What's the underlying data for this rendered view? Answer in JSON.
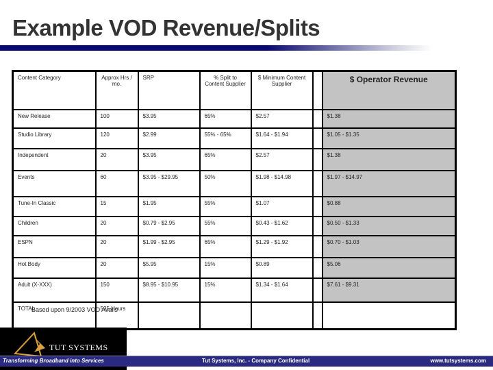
{
  "title": "Example VOD Revenue/Splits",
  "table": {
    "headers": [
      "Content Category",
      "Approx Hrs / mo.",
      "SRP",
      "% Split to Content Supplier",
      "$ Minimum Content Supplier",
      "",
      "$ Operator Revenue"
    ],
    "rows": [
      [
        "New Release",
        "100",
        "$3.95",
        "65%",
        "$2.57",
        "",
        "$1.38"
      ],
      [
        "Studio Library",
        "120",
        "$2.99",
        "55% - 65%",
        "$1.64 - $1.94",
        "",
        "$1.05 - $1.35"
      ],
      [
        "Independent",
        "20",
        "$3.95",
        "65%",
        "$2.57",
        "",
        "$1.38"
      ],
      [
        "Events",
        "60",
        "$3.95 - $29.95",
        "50%",
        "$1.98 - $14.98",
        "",
        "$1.97 - $14.97"
      ],
      [
        "Tune-In Classic",
        "15",
        "$1.95",
        "55%",
        "$1.07",
        "",
        "$0.88"
      ],
      [
        "Children",
        "20",
        "$0.79 - $2.95",
        "55%",
        "$0.43 - $1.62",
        "",
        "$0.50 - $1.33"
      ],
      [
        "ESPN",
        "20",
        "$1.99 - $2.95",
        "65%",
        "$1.29 - $1.92",
        "",
        "$0.70 - $1.03"
      ],
      [
        "Hot Body",
        "20",
        "$5.95",
        "15%",
        "$0.89",
        "",
        "$5.06"
      ],
      [
        "Adult (X-XXX)",
        "150",
        "$8.95 - $10.95",
        "15%",
        "$1.34 - $1.64",
        "",
        "$7.61 - $9.31"
      ],
      [
        "TOTAL",
        "525 Hours",
        "",
        "",
        "",
        "",
        ""
      ]
    ]
  },
  "note": "Based upon 9/2003 VOD Avails",
  "footer": {
    "logo": "TUT SYSTEMS",
    "tagline": "Transforming Broadband into Services",
    "confidential": "Tut Systems, Inc. - Company Confidential",
    "url": "www.tutsystems.com"
  },
  "colors": {
    "title_rule": "#0a0a6e",
    "operator_column": "#c3c3c3",
    "footer_band": "#2a2a80"
  }
}
